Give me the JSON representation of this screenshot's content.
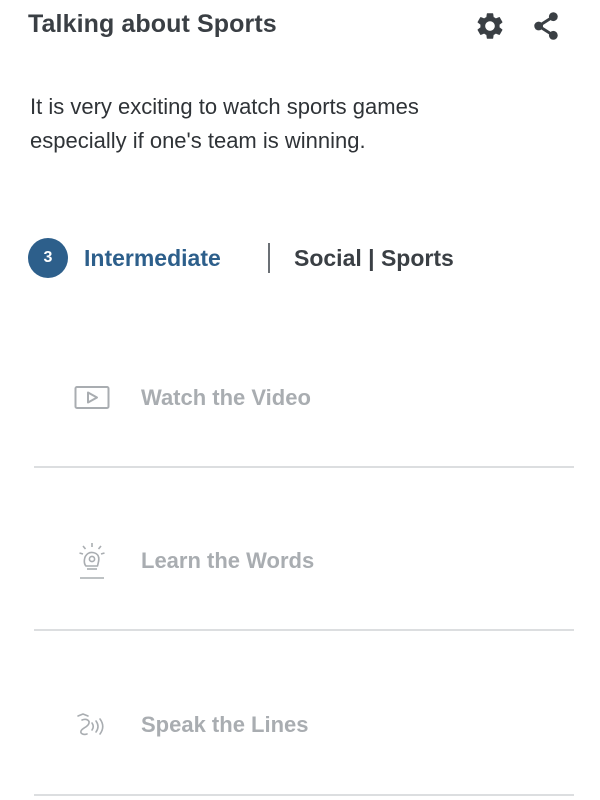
{
  "header": {
    "title": "Talking about Sports",
    "settings_icon": "gear-icon",
    "share_icon": "share-icon"
  },
  "description": "It is very exciting to watch sports games especially if one's team is winning.",
  "meta": {
    "level_number": "3",
    "level_label": "Intermediate",
    "category": "Social | Sports"
  },
  "steps": [
    {
      "label": "Watch the Video",
      "icon": "video-play-icon"
    },
    {
      "label": "Learn the Words",
      "icon": "lightbulb-icon"
    },
    {
      "label": "Speak the Lines",
      "icon": "speech-icon"
    }
  ],
  "colors": {
    "accent": "#2d5f8b",
    "title_text": "#3a3f44",
    "step_text": "#a9adb1",
    "divider": "#dcdee0"
  }
}
